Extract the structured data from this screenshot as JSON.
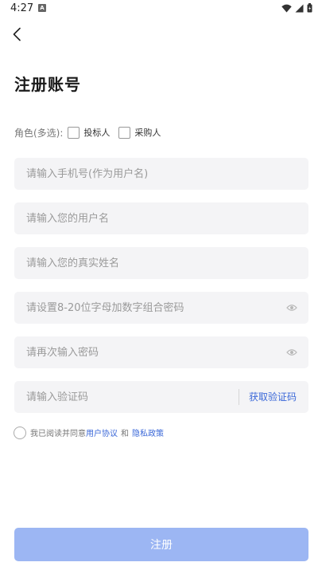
{
  "status_bar": {
    "time": "4:27",
    "notification_icon": "a-icon",
    "icons": [
      "wifi-icon",
      "signal-icon",
      "battery-icon"
    ]
  },
  "header": {
    "back_icon": "chevron-left-icon",
    "title": "注册账号"
  },
  "role": {
    "label": "角色(多选):",
    "options": [
      {
        "label": "投标人",
        "checked": false
      },
      {
        "label": "采购人",
        "checked": false
      }
    ]
  },
  "form": {
    "phone_placeholder": "请输入手机号(作为用户名)",
    "username_placeholder": "请输入您的用户名",
    "realname_placeholder": "请输入您的真实姓名",
    "password_placeholder": "请设置8-20位字母加数字组合密码",
    "confirm_placeholder": "请再次输入密码",
    "code_placeholder": "请输入验证码",
    "get_code_label": "获取验证码"
  },
  "agreement": {
    "prefix": "我已阅读并同意",
    "user_agreement": "用户协议",
    "and": "和",
    "privacy_policy": "隐私政策"
  },
  "submit": {
    "label": "注册"
  },
  "colors": {
    "accent": "#3b68d8",
    "button_disabled": "#9cb6f3",
    "field_bg": "#f4f4f6"
  }
}
